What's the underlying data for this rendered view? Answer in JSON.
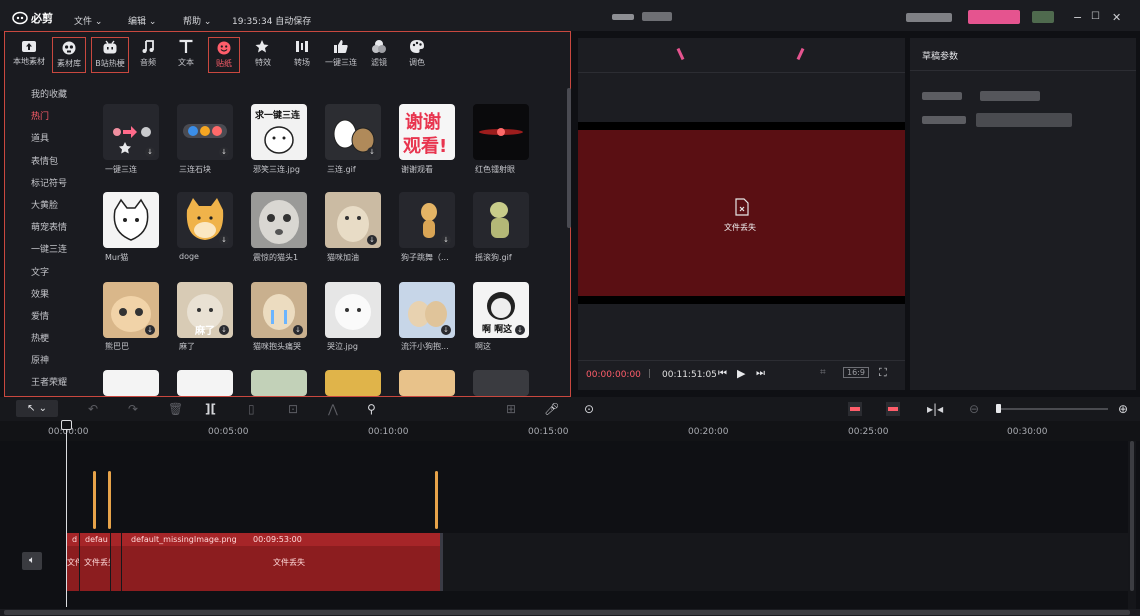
{
  "app": {
    "logo": "必剪",
    "menus": [
      "文件 ⌄",
      "编辑 ⌄",
      "帮助 ⌄"
    ],
    "autosave": "19:35:34 自动保存",
    "window_controls": [
      "−",
      "☐",
      "✕"
    ]
  },
  "toolbar": {
    "tools": [
      {
        "label": "本地素材",
        "icon": "upload-folder-icon"
      },
      {
        "label": "素材库",
        "icon": "material-library-icon"
      },
      {
        "label": "B站热梗",
        "icon": "bilibili-tv-icon"
      },
      {
        "label": "音频",
        "icon": "music-note-icon"
      },
      {
        "label": "文本",
        "icon": "text-t-icon"
      },
      {
        "label": "贴纸",
        "icon": "sticker-icon"
      },
      {
        "label": "特效",
        "icon": "star-effect-icon"
      },
      {
        "label": "转场",
        "icon": "transition-icon"
      },
      {
        "label": "一键三连",
        "icon": "thumbs-up-icon"
      },
      {
        "label": "滤镜",
        "icon": "filter-icon"
      },
      {
        "label": "调色",
        "icon": "palette-icon"
      }
    ]
  },
  "categories": [
    "我的收藏",
    "热门",
    "道具",
    "表情包",
    "标记符号",
    "大黄脸",
    "萌宠表情",
    "一键三连",
    "文字",
    "效果",
    "爱情",
    "热梗",
    "原神",
    "王者荣耀"
  ],
  "stickers": [
    [
      "一键三连",
      "三连石块",
      "邪笑三连.jpg",
      "三连.gif",
      "谢谢观看",
      "红色镭射眼"
    ],
    [
      "Mur猫",
      "doge",
      "震惊的猫头1",
      "猫咪加油",
      "狗子跳舞（...",
      "摇滚狗.gif"
    ],
    [
      "熊巴巴",
      "麻了",
      "猫咪抱头痛哭",
      "哭泣.jpg",
      "流汗小狗抱...",
      "啊这"
    ]
  ],
  "sticker_texts": {
    "s1_2": "求一键三连",
    "s1_4a": "谢谢",
    "s1_4b": "观看!",
    "s2_1": "麻了",
    "s2_5": "啊 啊这"
  },
  "preview": {
    "missing_label": "文件丢失",
    "current_time": "00:00:00:00",
    "total_time": "00:11:51:05",
    "ratio": "16:9"
  },
  "params": {
    "title": "草稿参数"
  },
  "ruler": [
    "00:00:00",
    "00:05:00",
    "00:10:00",
    "00:15:00",
    "00:20:00",
    "00:25:00",
    "00:30:00"
  ],
  "clips": {
    "c1_head": "d",
    "c1_body": "文件",
    "c2_head": "defau",
    "c2_body": "文件丢失",
    "c3_head": "default_missingImage.png",
    "c3_duration": "00:09:53:00",
    "c3_body": "文件丢失"
  },
  "colors": {
    "accent": "#ff5d6a",
    "highlight_border": "#c9483f",
    "clip": "#8c1d1f",
    "preview_bg": "#5a0f13"
  }
}
